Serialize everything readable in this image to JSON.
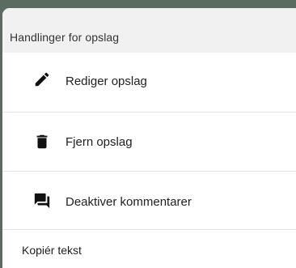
{
  "sheet": {
    "title": "Handlinger for opslag",
    "actions": [
      {
        "label": "Rediger opslag",
        "icon": "pencil-icon"
      },
      {
        "label": "Fjern opslag",
        "icon": "trash-icon"
      },
      {
        "label": "Deaktiver kommentarer",
        "icon": "chat-bubbles-icon"
      }
    ],
    "plain_actions": [
      {
        "label": "Kopiér tekst"
      }
    ]
  },
  "colors": {
    "backdrop": "#5b6b5f",
    "header_bg": "#f1f1f1",
    "text": "#1f1f1f",
    "divider": "#e3e3e3"
  }
}
